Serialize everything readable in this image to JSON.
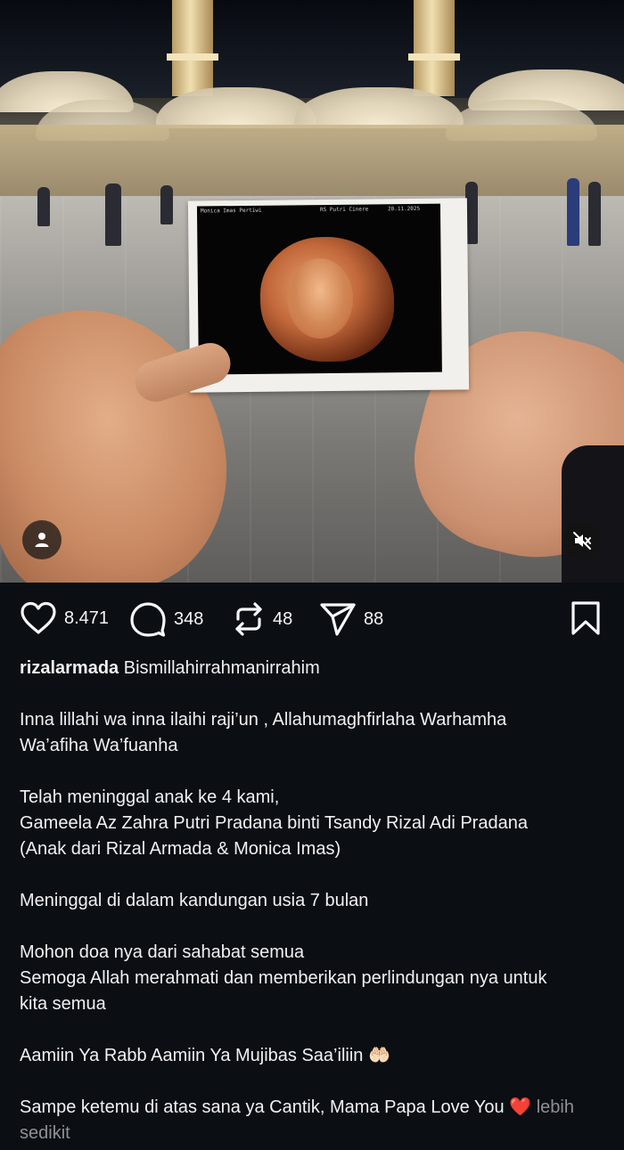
{
  "post": {
    "likes": "8.471",
    "comments": "348",
    "reposts": "48",
    "shares": "88",
    "icons": {
      "like": "heart-icon",
      "comment": "comment-bubble-icon",
      "repost": "repost-icon",
      "share": "send-icon",
      "save": "bookmark-icon",
      "user": "user-icon",
      "mute": "speaker-muted-icon"
    }
  },
  "caption": {
    "username": "rizalarmada",
    "line1": "Bismillahirrahmanirrahim",
    "line2": "Inna lillahi wa inna ilaihi raji’un , Allahumaghfirlaha Warhamha",
    "line3": "Wa’afiha Wa’fuanha",
    "line4": "Telah meninggal anak ke 4 kami,",
    "line5": "Gameela Az Zahra Putri Pradana binti Tsandy Rizal Adi Pradana",
    "line6": "(Anak dari Rizal Armada & Monica Imas)",
    "line7": "Meninggal di dalam kandungan usia 7 bulan",
    "line8": "Mohon doa nya dari sahabat semua",
    "line9": "Semoga Allah merahmati dan memberikan perlindungan nya untuk",
    "line10": "kita semua",
    "line11": "Aamiin Ya Rabb Aamiin Ya Mujibas Saa’iliin",
    "line11_emoji": "🤲🏻",
    "line12": "Sampe ketemu di atas sana ya Cantik, Mama Papa Love You",
    "line12_emoji": "❤️",
    "more_label": "lebih",
    "more_label2": "sedikit"
  },
  "ultrasound": {
    "header_left": "Monica Imas Pertiwi",
    "header_mid": "RS Putri Cinere",
    "header_right": "20.11.2025"
  }
}
